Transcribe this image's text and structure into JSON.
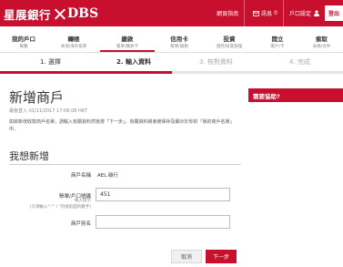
{
  "brand": {
    "name_cn": "星展銀行",
    "name_en": "DBS",
    "color": "#c8102e"
  },
  "util_bar": {
    "items": [
      {
        "label": "網頁指南",
        "icon": "lock-icon"
      },
      {
        "label": "訊息",
        "badge": "0"
      },
      {
        "label": "戶口設定",
        "icon": "user-icon"
      }
    ],
    "logout_label": "登出"
  },
  "nav": {
    "items": [
      {
        "main": "我的戶口",
        "sub": "概覽"
      },
      {
        "main": "轉賬",
        "sub": "本地/海外賬單"
      },
      {
        "main": "繳款",
        "sub": "帳單/繳款卡"
      },
      {
        "main": "信用卡",
        "sub": "帳單/服務"
      },
      {
        "main": "投資",
        "sub": "證券/財富管理"
      },
      {
        "main": "開立",
        "sub": "帳戶/卡"
      },
      {
        "main": "索取",
        "sub": "表格/文件"
      }
    ],
    "active_index": 2
  },
  "steps": {
    "items": [
      {
        "label": "1. 選擇",
        "state": "done"
      },
      {
        "label": "2. 輸入資料",
        "state": "active"
      },
      {
        "label": "3. 核對資料",
        "state": "future"
      },
      {
        "label": "4. 完成",
        "state": "future"
      }
    ],
    "progress": 0.5
  },
  "page": {
    "title": "新增商戶",
    "timestamp": "最後登入 01/11/2017 17:06:08 HKT",
    "instruction": "如欲新增收款商戶名單，請輸入有關資料然後按「下一步」。有關資料將會被保存及顯示於你的「我的商戶名單」中。",
    "section_title": "我想新增"
  },
  "form": {
    "merchant_label": "商戶名稱",
    "merchant_value": "AEL 碳行",
    "account_label": "賬單/戶口號碼",
    "account_value": "451",
    "account_hint": "輸入提示\n(只須輸入\"-\"\" / \"符號前面的數字)",
    "alias_label": "商戶別名",
    "alias_value": ""
  },
  "buttons": {
    "cancel": "取消",
    "next": "下一步"
  },
  "help": {
    "title": "需要協助?"
  }
}
